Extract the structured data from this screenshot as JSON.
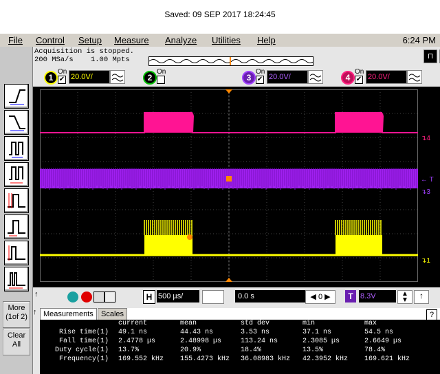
{
  "saved": "Saved:  09 SEP 2017  18:24:45",
  "menu": [
    "File",
    "Control",
    "Setup",
    "Measure",
    "Analyze",
    "Utilities",
    "Help"
  ],
  "clock": "6:24 PM",
  "acquisition": {
    "status": "Acquisition is stopped.",
    "rate": "200 MSa/s",
    "points": "1.00 Mpts"
  },
  "channels": [
    {
      "num": "1",
      "on_label": "On",
      "checked": "✔",
      "scale": "20.0V/",
      "color": "#ffff00"
    },
    {
      "num": "2",
      "on_label": "On",
      "checked": "",
      "scale": "",
      "color": "#00c000"
    },
    {
      "num": "3",
      "on_label": "On",
      "checked": "✔",
      "scale": "20.0V/",
      "color": "#a040ff"
    },
    {
      "num": "4",
      "on_label": "On",
      "checked": "✔",
      "scale": "20.0V/",
      "color": "#ff2080"
    }
  ],
  "side_buttons": {
    "more": "More\n(1of 2)",
    "clear": "Clear\nAll"
  },
  "right_labels": {
    "ch4": "4",
    "trig": "← T",
    "ch3": "3",
    "ch1": "1"
  },
  "timebase": {
    "label": "H",
    "value": "500 µs/",
    "delay": "0.0 s"
  },
  "trigger": {
    "label": "T",
    "value": "8.3V"
  },
  "tabs": {
    "measurements": "Measurements",
    "scales": "Scales"
  },
  "measurements": {
    "headers": [
      "current",
      "mean",
      "std dev",
      "min",
      "max"
    ],
    "rows": [
      {
        "name": "Rise time(1)",
        "current": "49.1 ns",
        "mean": "44.43 ns",
        "std": "3.53 ns",
        "min": "37.1 ns",
        "max": "54.5 ns",
        "color": "#ffff00"
      },
      {
        "name": "Fall time(1)",
        "current": "2.4778 µs",
        "mean": "2.48998 µs",
        "std": "113.24 ns",
        "min": "2.3085 µs",
        "max": "2.6649 µs",
        "color": "#ff8800"
      },
      {
        "name": "Duty cycle(1)",
        "current": "13.7%",
        "mean": "20.9%",
        "std": "18.4%",
        "min": "13.5%",
        "max": "78.4%",
        "color": "#ff8800"
      },
      {
        "name": "Frequency(1)",
        "current": "169.552 kHz",
        "mean": "155.4273 kHz",
        "std": "36.08983 kHz",
        "min": "42.3952 kHz",
        "max": "169.621 kHz",
        "color": "#ff8800"
      }
    ]
  },
  "colors": {
    "ch1": "#ffff00",
    "ch3": "#a020f0",
    "ch4": "#ff1493",
    "marker": "#ff8800"
  }
}
